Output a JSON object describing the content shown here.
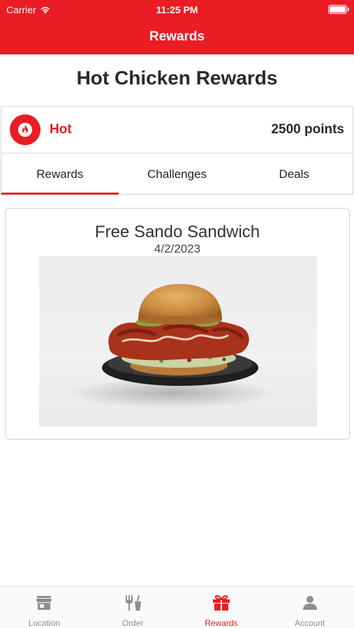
{
  "status_bar": {
    "carrier": "Carrier",
    "time": "11:25 PM"
  },
  "nav": {
    "title": "Rewards"
  },
  "page": {
    "title": "Hot Chicken Rewards"
  },
  "tier": {
    "name": "Hot",
    "points": "2500 points",
    "icon": "flame-icon"
  },
  "tabs": [
    {
      "label": "Rewards",
      "active": true
    },
    {
      "label": "Challenges",
      "active": false
    },
    {
      "label": "Deals",
      "active": false
    }
  ],
  "rewards": [
    {
      "title": "Free Sando Sandwich",
      "date": "4/2/2023",
      "image": "hot-chicken-sandwich-photo"
    }
  ],
  "tab_bar": [
    {
      "label": "Location",
      "icon": "store-icon",
      "active": false
    },
    {
      "label": "Order",
      "icon": "fork-knife-icon",
      "active": false
    },
    {
      "label": "Rewards",
      "icon": "gift-icon",
      "active": true
    },
    {
      "label": "Account",
      "icon": "person-icon",
      "active": false
    }
  ],
  "colors": {
    "brand": "#ea1c24",
    "inactive": "#8e8e93"
  }
}
